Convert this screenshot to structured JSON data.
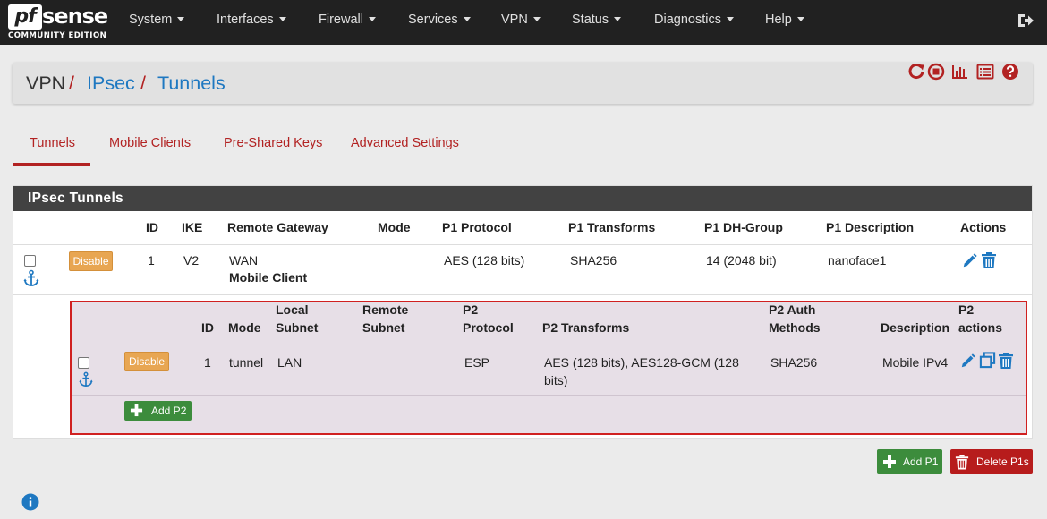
{
  "brand": {
    "pf": "pf",
    "sense": "sense",
    "edition": "COMMUNITY EDITION"
  },
  "nav": {
    "items": [
      "System",
      "Interfaces",
      "Firewall",
      "Services",
      "VPN",
      "Status",
      "Diagnostics",
      "Help"
    ],
    "logout_icon": "logout-icon"
  },
  "breadcrumb": {
    "vpn": "VPN",
    "ipsec": "IPsec",
    "tunnels": "Tunnels",
    "sep": "/"
  },
  "toolbar_icons": [
    "restart-icon",
    "stop-icon",
    "chart-icon",
    "log-icon",
    "help-icon"
  ],
  "tabs": [
    "Tunnels",
    "Mobile Clients",
    "Pre-Shared Keys",
    "Advanced Settings"
  ],
  "panel": {
    "title": "IPsec Tunnels",
    "columns": [
      "ID",
      "IKE",
      "Remote Gateway",
      "Mode",
      "P1 Protocol",
      "P1 Transforms",
      "P1 DH-Group",
      "P1 Description",
      "Actions"
    ],
    "rows": [
      {
        "disable_label": "Disable",
        "id": "1",
        "ike": "V2",
        "gateway": "WAN",
        "gateway_sub": "Mobile Client",
        "mode": "",
        "p1_protocol": "AES (128 bits)",
        "p1_transforms": "SHA256",
        "p1_dh_group": "14 (2048 bit)",
        "p1_description": "nanoface1"
      }
    ]
  },
  "p2": {
    "columns": {
      "id": "ID",
      "mode": "Mode",
      "local_1": "Local",
      "local_2": "Subnet",
      "remote_1": "Remote",
      "remote_2": "Subnet",
      "proto_1": "P2",
      "proto_2": "Protocol",
      "transforms": "P2 Transforms",
      "auth_1": "P2 Auth",
      "auth_2": "Methods",
      "description": "Description",
      "actions_1": "P2",
      "actions_2": "actions"
    },
    "rows": [
      {
        "disable_label": "Disable",
        "id": "1",
        "mode": "tunnel",
        "local_subnet": "LAN",
        "remote_subnet": "",
        "protocol": "ESP",
        "transforms_1": "AES (128 bits), AES128-GCM (128",
        "transforms_2": "bits)",
        "auth": "SHA256",
        "description": "Mobile IPv4"
      }
    ],
    "add_label": "Add P2"
  },
  "buttons": {
    "add_p1": "Add P1",
    "delete_p1s": "Delete P1s"
  },
  "colors": {
    "accent_red": "#b22222",
    "link_blue": "#1e78c1",
    "navbar": "#212121",
    "panel_head": "#424242"
  }
}
